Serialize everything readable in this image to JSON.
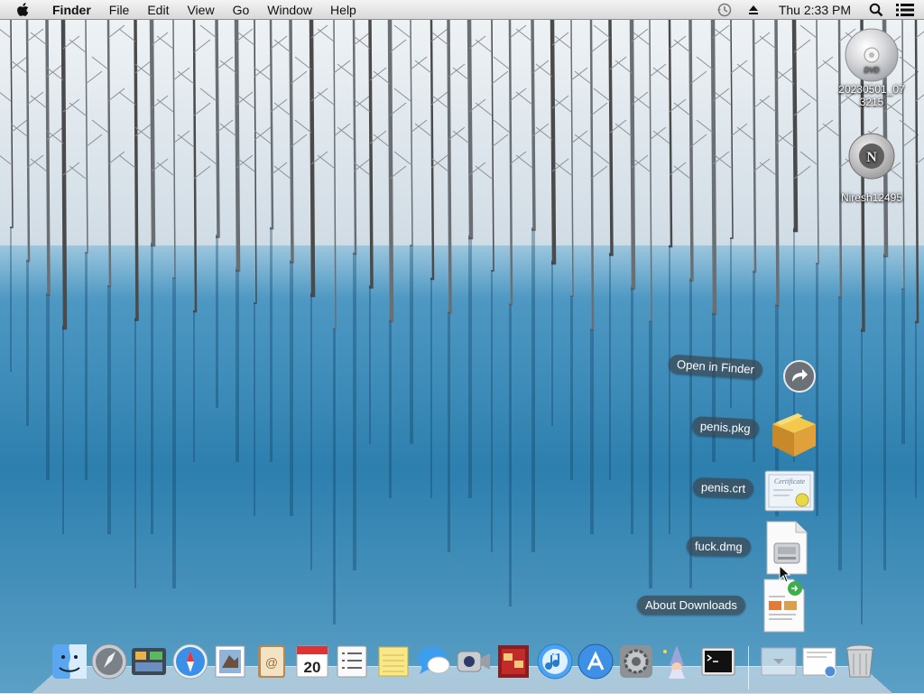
{
  "menubar": {
    "app_name": "Finder",
    "menus": [
      "File",
      "Edit",
      "View",
      "Go",
      "Window",
      "Help"
    ],
    "clock": "Thu 2:33 PM"
  },
  "desktop": {
    "icons": [
      {
        "label": "20230501_07\n3215",
        "icon": "dvd-disc-icon"
      },
      {
        "label": "Niresh12495",
        "icon": "niresh-disk-icon"
      }
    ]
  },
  "stack": {
    "items": [
      {
        "label": "Open in Finder",
        "icon": "open-in-finder-arrow-icon"
      },
      {
        "label": "penis.pkg",
        "icon": "package-icon"
      },
      {
        "label": "penis.crt",
        "icon": "certificate-icon"
      },
      {
        "label": "fuck.dmg",
        "icon": "disk-image-icon"
      },
      {
        "label": "About Downloads",
        "icon": "document-icon"
      }
    ]
  },
  "dock": {
    "apps": [
      "Finder",
      "Launchpad",
      "Mission Control",
      "Safari",
      "Mail",
      "Contacts",
      "Calendar",
      "Reminders",
      "Notes",
      "Messages",
      "FaceTime",
      "Photo Booth",
      "iTunes",
      "App Store",
      "System Preferences",
      "Kext Utility",
      "Terminal",
      "Downloads",
      "Documents",
      "Trash"
    ],
    "calendar_day": "20"
  },
  "colors": {
    "menubar_bg": "#e6e6e6",
    "label_bg": "#3c4650"
  }
}
